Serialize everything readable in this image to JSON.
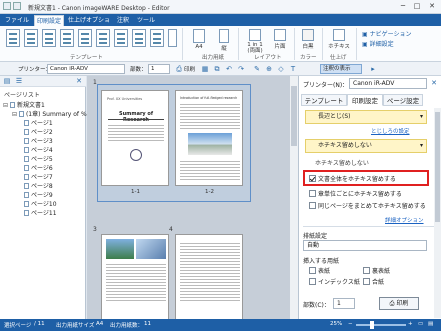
{
  "window": {
    "title": "新規文書1 - Canon imageWARE Desktop - Editor",
    "minimize": "─",
    "maximize": "□",
    "close": "✕"
  },
  "ribbon_tabs": [
    "ファイル",
    "印刷設定",
    "仕上げオプション",
    "注釈",
    "ツール"
  ],
  "ribbon": {
    "group_template": "テンプレート",
    "group_output": "出力用紙",
    "group_layout": "レイアウト",
    "group_color": "カラー",
    "group_finish": "仕上げ",
    "btn_paper_size": "A4",
    "btn_orientation": "縦",
    "btn_layout": "1 in 1\n(両面)",
    "btn_duplex": "片面",
    "btn_color": "白黒",
    "btn_staple": "ホチキス",
    "nav_label": "ナビゲーション",
    "settings_label": "詳細設定"
  },
  "toolbar": {
    "printer_label": "プリンター：",
    "printer_value": "Canon iR-ADV",
    "copies_label": "部数：",
    "copies_value": "1",
    "print_label": "印刷",
    "annotation_view_label": "注釈の表示"
  },
  "left_pane": {
    "title": "ページリスト",
    "items": [
      {
        "label": "新規文書1",
        "level": 0
      },
      {
        "label": "(1章) Summary of %",
        "level": 1
      },
      {
        "label": "ページ1",
        "level": 2
      },
      {
        "label": "ページ2",
        "level": 2
      },
      {
        "label": "ページ3",
        "level": 2
      },
      {
        "label": "ページ4",
        "level": 2
      },
      {
        "label": "ページ5",
        "level": 2
      },
      {
        "label": "ページ6",
        "level": 2
      },
      {
        "label": "ページ7",
        "level": 2
      },
      {
        "label": "ページ8",
        "level": 2
      },
      {
        "label": "ページ9",
        "level": 2
      },
      {
        "label": "ページ10",
        "level": 2
      },
      {
        "label": "ページ11",
        "level": 2
      }
    ]
  },
  "center": {
    "sheet1_number": "1",
    "sheet2_number": "2",
    "sheet3_number": "3",
    "sheet4_number": "4",
    "page1_title": "Summary of Research",
    "page1_header": "Prof. XX Universities",
    "page2_header": "Introduction of full-fledged research",
    "page3_header": "Prof. XX Universities",
    "caption_1_1": "1-1",
    "caption_1_2": "1-2"
  },
  "right_pane": {
    "printer_label": "プリンター(N)：",
    "printer_value": "Canon iR-ADV",
    "tabs": [
      "テンプレート",
      "印刷設定",
      "ページ設定"
    ],
    "orientation_value": "長辺とじ(S)",
    "binding_settings_link": "とじしろの設定",
    "staple_dropdown_value": "ホチキス留めしない",
    "staple_option_none": "ホチキス留めしない",
    "check_whole_doc": "文書全体をホチキス留めする",
    "check_per_chapter": "章単位ごとにホチキス留めする",
    "check_same_sheet": "同じページをまとめてホチキス留めする",
    "detail_option_link": "詳細オプション",
    "output_label": "排紙設定",
    "output_value": "自動",
    "insert_label": "挿入する用紙",
    "opt_cover": "表紙",
    "opt_back": "裏表紙",
    "opt_index": "インデックス紙",
    "opt_blank": "合紙",
    "copies_label": "部数(C)：",
    "copies_value": "1",
    "print_button": "印刷"
  },
  "status": {
    "page_label": "選択ページ",
    "page_value": "/ 11",
    "paper_label": "出力用紙サイズ",
    "paper_value": "A4",
    "count_label": "出力用紙数：",
    "count_value": "11",
    "zoom": "25%"
  }
}
